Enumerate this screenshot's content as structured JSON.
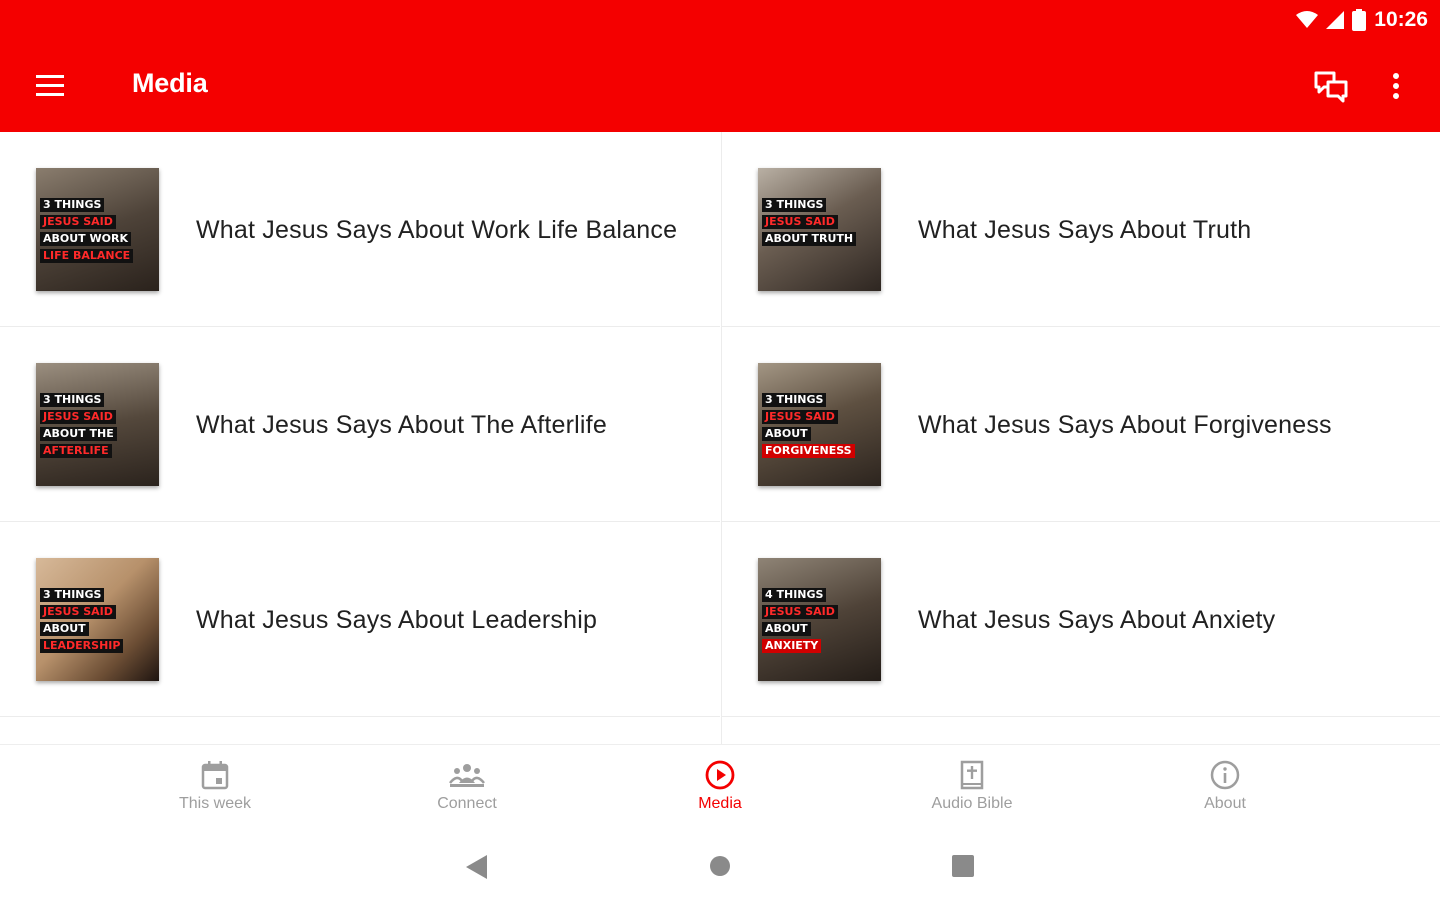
{
  "status_bar": {
    "time": "10:26"
  },
  "app_bar": {
    "title": "Media"
  },
  "colors": {
    "brand": "#f40000",
    "active_nav": "#f40000",
    "inactive_nav": "#9e9e9e"
  },
  "media_items": [
    {
      "title": "What Jesus Says About Work Life Balance",
      "thumb_words": [
        "3 THINGS",
        "JESUS SAID",
        "ABOUT WORK",
        "LIFE BALANCE"
      ]
    },
    {
      "title": "What Jesus Says About Truth",
      "thumb_words": [
        "3 THINGS",
        "JESUS SAID",
        "ABOUT TRUTH"
      ]
    },
    {
      "title": "What Jesus Says About The Afterlife",
      "thumb_words": [
        "3 THINGS",
        "JESUS SAID",
        "ABOUT THE",
        "AFTERLIFE"
      ]
    },
    {
      "title": "What Jesus Says About Forgiveness",
      "thumb_words": [
        "3 THINGS",
        "JESUS SAID",
        "ABOUT",
        "FORGIVENESS"
      ]
    },
    {
      "title": "What Jesus Says About Leadership",
      "thumb_words": [
        "3 THINGS",
        "JESUS SAID",
        "ABOUT",
        "LEADERSHIP"
      ]
    },
    {
      "title": "What Jesus Says About Anxiety",
      "thumb_words": [
        "4 THINGS",
        "JESUS SAID",
        "ABOUT",
        "ANXIETY"
      ]
    }
  ],
  "bottom_nav": [
    {
      "label": "This week",
      "icon": "calendar-icon",
      "active": false
    },
    {
      "label": "Connect",
      "icon": "group-icon",
      "active": false
    },
    {
      "label": "Media",
      "icon": "play-circle-icon",
      "active": true
    },
    {
      "label": "Audio Bible",
      "icon": "bible-icon",
      "active": false
    },
    {
      "label": "About",
      "icon": "info-icon",
      "active": false
    }
  ]
}
